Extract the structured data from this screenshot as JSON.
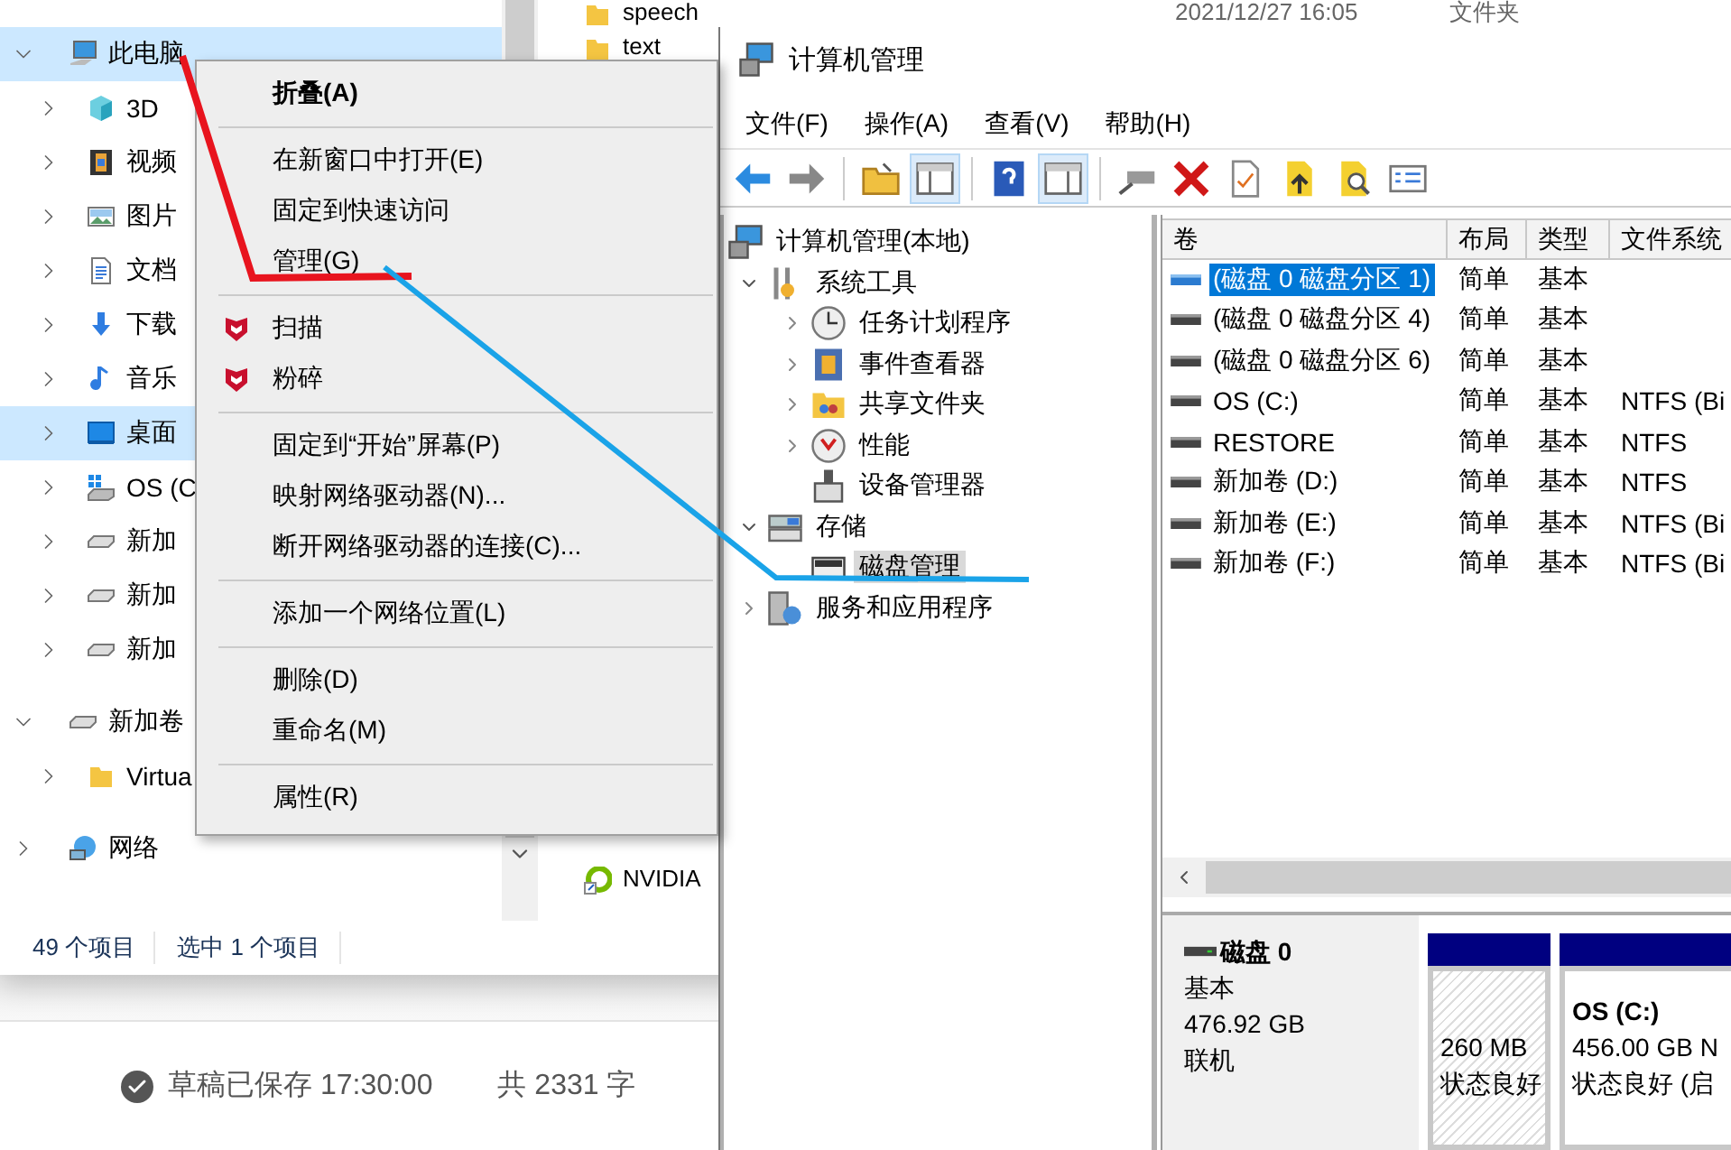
{
  "explorer": {
    "nav_tree": [
      {
        "label": "此电脑",
        "kind": "computer",
        "expanded": true,
        "selected": true,
        "children": [
          {
            "label": "3D",
            "kind": "cube",
            "expanded": false,
            "selected": false
          },
          {
            "label": "视频",
            "kind": "film",
            "expanded": false,
            "selected": false
          },
          {
            "label": "图片",
            "kind": "picture",
            "expanded": false,
            "selected": false
          },
          {
            "label": "文档",
            "kind": "document",
            "expanded": false,
            "selected": false
          },
          {
            "label": "下载",
            "kind": "download",
            "expanded": false,
            "selected": false
          },
          {
            "label": "音乐",
            "kind": "music",
            "expanded": false,
            "selected": false
          },
          {
            "label": "桌面",
            "kind": "desktop",
            "expanded": false,
            "selected": true
          },
          {
            "label": "OS (C",
            "kind": "windows-drive",
            "expanded": false,
            "selected": false
          },
          {
            "label": "新加",
            "kind": "drive",
            "expanded": false,
            "selected": false
          },
          {
            "label": "新加",
            "kind": "drive",
            "expanded": false,
            "selected": false
          },
          {
            "label": "新加",
            "kind": "drive",
            "expanded": false,
            "selected": false
          }
        ]
      },
      {
        "label": "新加卷",
        "kind": "drive",
        "expanded": true,
        "selected": false,
        "children": [
          {
            "label": "Virtua",
            "kind": "folder",
            "expanded": false,
            "selected": false
          }
        ]
      },
      {
        "label": "网络",
        "kind": "network",
        "expanded": false,
        "selected": false
      }
    ],
    "file_list": {
      "top_rows": [
        {
          "name": "speech",
          "kind": "folder",
          "modified": "2021/12/27 16:05",
          "type": "文件夹"
        },
        {
          "name": "text",
          "kind": "folder"
        }
      ],
      "bottom_rows": [
        {
          "name": "NVIDIA",
          "kind": "shortcut"
        }
      ]
    },
    "status": {
      "item_count": "49 个项目",
      "selection": "选中 1 个项目"
    }
  },
  "context_menu": {
    "groups": [
      [
        {
          "label": "折叠(A)",
          "kind": "default"
        }
      ],
      [
        {
          "label": "在新窗口中打开(E)",
          "kind": "plain"
        },
        {
          "label": "固定到快速访问",
          "kind": "plain"
        },
        {
          "label": "管理(G)",
          "kind": "plain"
        }
      ],
      [
        {
          "label": "扫描",
          "kind": "shield"
        },
        {
          "label": "粉碎",
          "kind": "shield"
        }
      ],
      [
        {
          "label": "固定到“开始”屏幕(P)",
          "kind": "plain"
        },
        {
          "label": "映射网络驱动器(N)...",
          "kind": "plain"
        },
        {
          "label": "断开网络驱动器的连接(C)...",
          "kind": "plain"
        }
      ],
      [
        {
          "label": "添加一个网络位置(L)",
          "kind": "plain"
        }
      ],
      [
        {
          "label": "删除(D)",
          "kind": "plain"
        },
        {
          "label": "重命名(M)",
          "kind": "plain"
        }
      ],
      [
        {
          "label": "属性(R)",
          "kind": "plain"
        }
      ]
    ]
  },
  "management": {
    "title": "计算机管理",
    "menu": [
      "文件(F)",
      "操作(A)",
      "查看(V)",
      "帮助(H)"
    ],
    "toolbar": [
      {
        "kind": "back",
        "pressed": false
      },
      {
        "kind": "forward",
        "pressed": false
      },
      {
        "kind": "separator"
      },
      {
        "kind": "up-folder",
        "pressed": false
      },
      {
        "kind": "console-tree",
        "pressed": true
      },
      {
        "kind": "separator"
      },
      {
        "kind": "help",
        "pressed": false
      },
      {
        "kind": "action-pane",
        "pressed": true
      },
      {
        "kind": "separator"
      },
      {
        "kind": "connect",
        "pressed": false
      },
      {
        "kind": "delete",
        "pressed": false
      },
      {
        "kind": "properties",
        "pressed": false
      },
      {
        "kind": "up-arrow",
        "pressed": false
      },
      {
        "kind": "search",
        "pressed": false
      },
      {
        "kind": "list",
        "pressed": false
      }
    ],
    "tree": [
      {
        "label": "计算机管理(本地)",
        "kind": "computer-management",
        "selected": false,
        "children": [
          {
            "label": "系统工具",
            "kind": "tools",
            "expanded": true,
            "selected": false,
            "children": [
              {
                "label": "任务计划程序",
                "kind": "clock",
                "expanded": false,
                "selected": false
              },
              {
                "label": "事件查看器",
                "kind": "event-viewer",
                "expanded": false,
                "selected": false
              },
              {
                "label": "共享文件夹",
                "kind": "shared-folder",
                "expanded": false,
                "selected": false
              },
              {
                "label": "性能",
                "kind": "performance",
                "expanded": false,
                "selected": false
              },
              {
                "label": "设备管理器",
                "kind": "device-manager",
                "selected": false
              }
            ]
          },
          {
            "label": "存储",
            "kind": "storage",
            "expanded": true,
            "selected": false,
            "children": [
              {
                "label": "磁盘管理",
                "kind": "disk",
                "selected": true
              }
            ]
          },
          {
            "label": "服务和应用程序",
            "kind": "services",
            "expanded": false,
            "selected": false
          }
        ]
      }
    ],
    "volumes": {
      "columns": [
        "卷",
        "布局",
        "类型",
        "文件系统"
      ],
      "rows": [
        {
          "volume": "(磁盘 0 磁盘分区 1)",
          "layout": "简单",
          "type": "基本",
          "selected": true
        },
        {
          "volume": "(磁盘 0 磁盘分区 4)",
          "layout": "简单",
          "type": "基本",
          "selected": false
        },
        {
          "volume": "(磁盘 0 磁盘分区 6)",
          "layout": "简单",
          "type": "基本",
          "selected": false
        },
        {
          "volume": "OS (C:)",
          "layout": "简单",
          "type": "基本",
          "file_system": "NTFS (Bi",
          "selected": false
        },
        {
          "volume": "RESTORE",
          "layout": "简单",
          "type": "基本",
          "file_system": "NTFS",
          "selected": false
        },
        {
          "volume": "新加卷 (D:)",
          "layout": "简单",
          "type": "基本",
          "file_system": "NTFS",
          "selected": false
        },
        {
          "volume": "新加卷 (E:)",
          "layout": "简单",
          "type": "基本",
          "file_system": "NTFS (Bi",
          "selected": false
        },
        {
          "volume": "新加卷 (F:)",
          "layout": "简单",
          "type": "基本",
          "file_system": "NTFS (Bi",
          "selected": false
        }
      ]
    },
    "disk": {
      "name": "磁盘 0",
      "type": "基本",
      "size": "476.92 GB",
      "status": "联机",
      "partitions": [
        {
          "kind": "hatched",
          "size": "260 MB",
          "status": "状态良好"
        },
        {
          "kind": "primary",
          "name": "OS  (C:)",
          "size": "456.00 GB N",
          "status": "状态良好 (启"
        }
      ]
    }
  },
  "editor_footer": {
    "save_status": "草稿已保存 17:30:00",
    "word_count": "共 2331 字"
  }
}
